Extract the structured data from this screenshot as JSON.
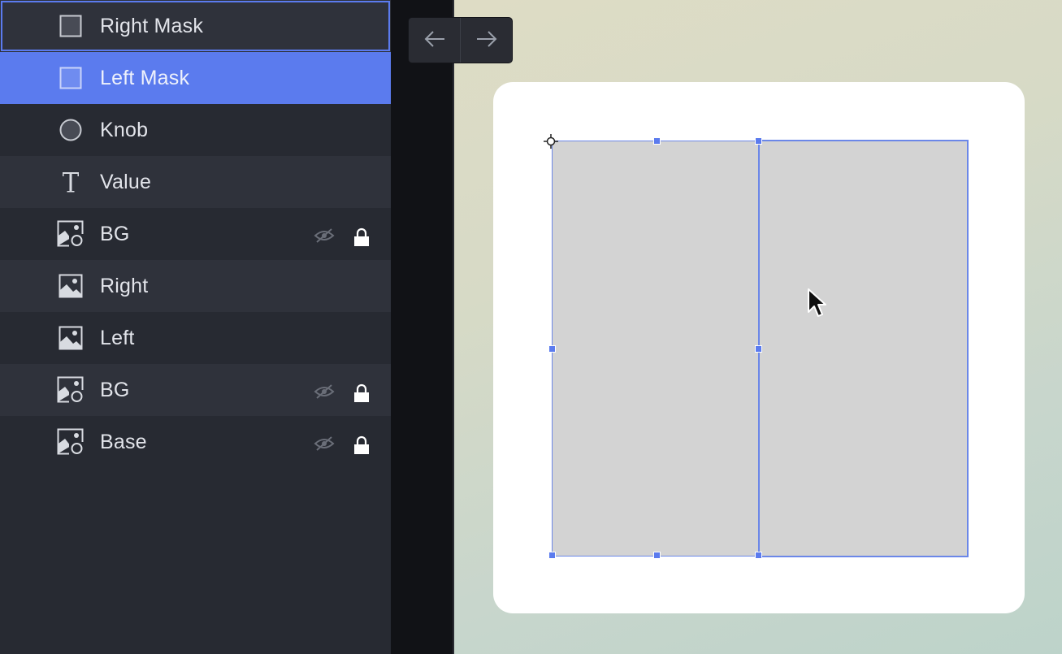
{
  "layers": [
    {
      "label": "Right Mask",
      "icon": "square-icon",
      "state": "hovered",
      "hidden": false,
      "locked": false
    },
    {
      "label": "Left Mask",
      "icon": "square-icon",
      "state": "selected",
      "hidden": false,
      "locked": false
    },
    {
      "label": "Knob",
      "icon": "circle-icon",
      "state": "normal",
      "hidden": false,
      "locked": false
    },
    {
      "label": "Value",
      "icon": "text-icon",
      "state": "normal",
      "hidden": false,
      "locked": false
    },
    {
      "label": "BG",
      "icon": "image-shapes-icon",
      "state": "normal",
      "hidden": true,
      "locked": true
    },
    {
      "label": "Right",
      "icon": "image-icon",
      "state": "normal",
      "hidden": false,
      "locked": false
    },
    {
      "label": "Left",
      "icon": "image-icon",
      "state": "normal",
      "hidden": false,
      "locked": false
    },
    {
      "label": "BG",
      "icon": "image-shapes-icon",
      "state": "normal",
      "hidden": true,
      "locked": true
    },
    {
      "label": "Base",
      "icon": "image-shapes-icon",
      "state": "normal",
      "hidden": true,
      "locked": true
    }
  ],
  "nav": {
    "back_icon": "arrow-left-icon",
    "forward_icon": "arrow-right-icon"
  },
  "colors": {
    "accent": "#5b7bee",
    "panel_bg": "#272a32",
    "row_alt_bg": "#2f323b",
    "mask_fill": "#d3d3d3"
  }
}
